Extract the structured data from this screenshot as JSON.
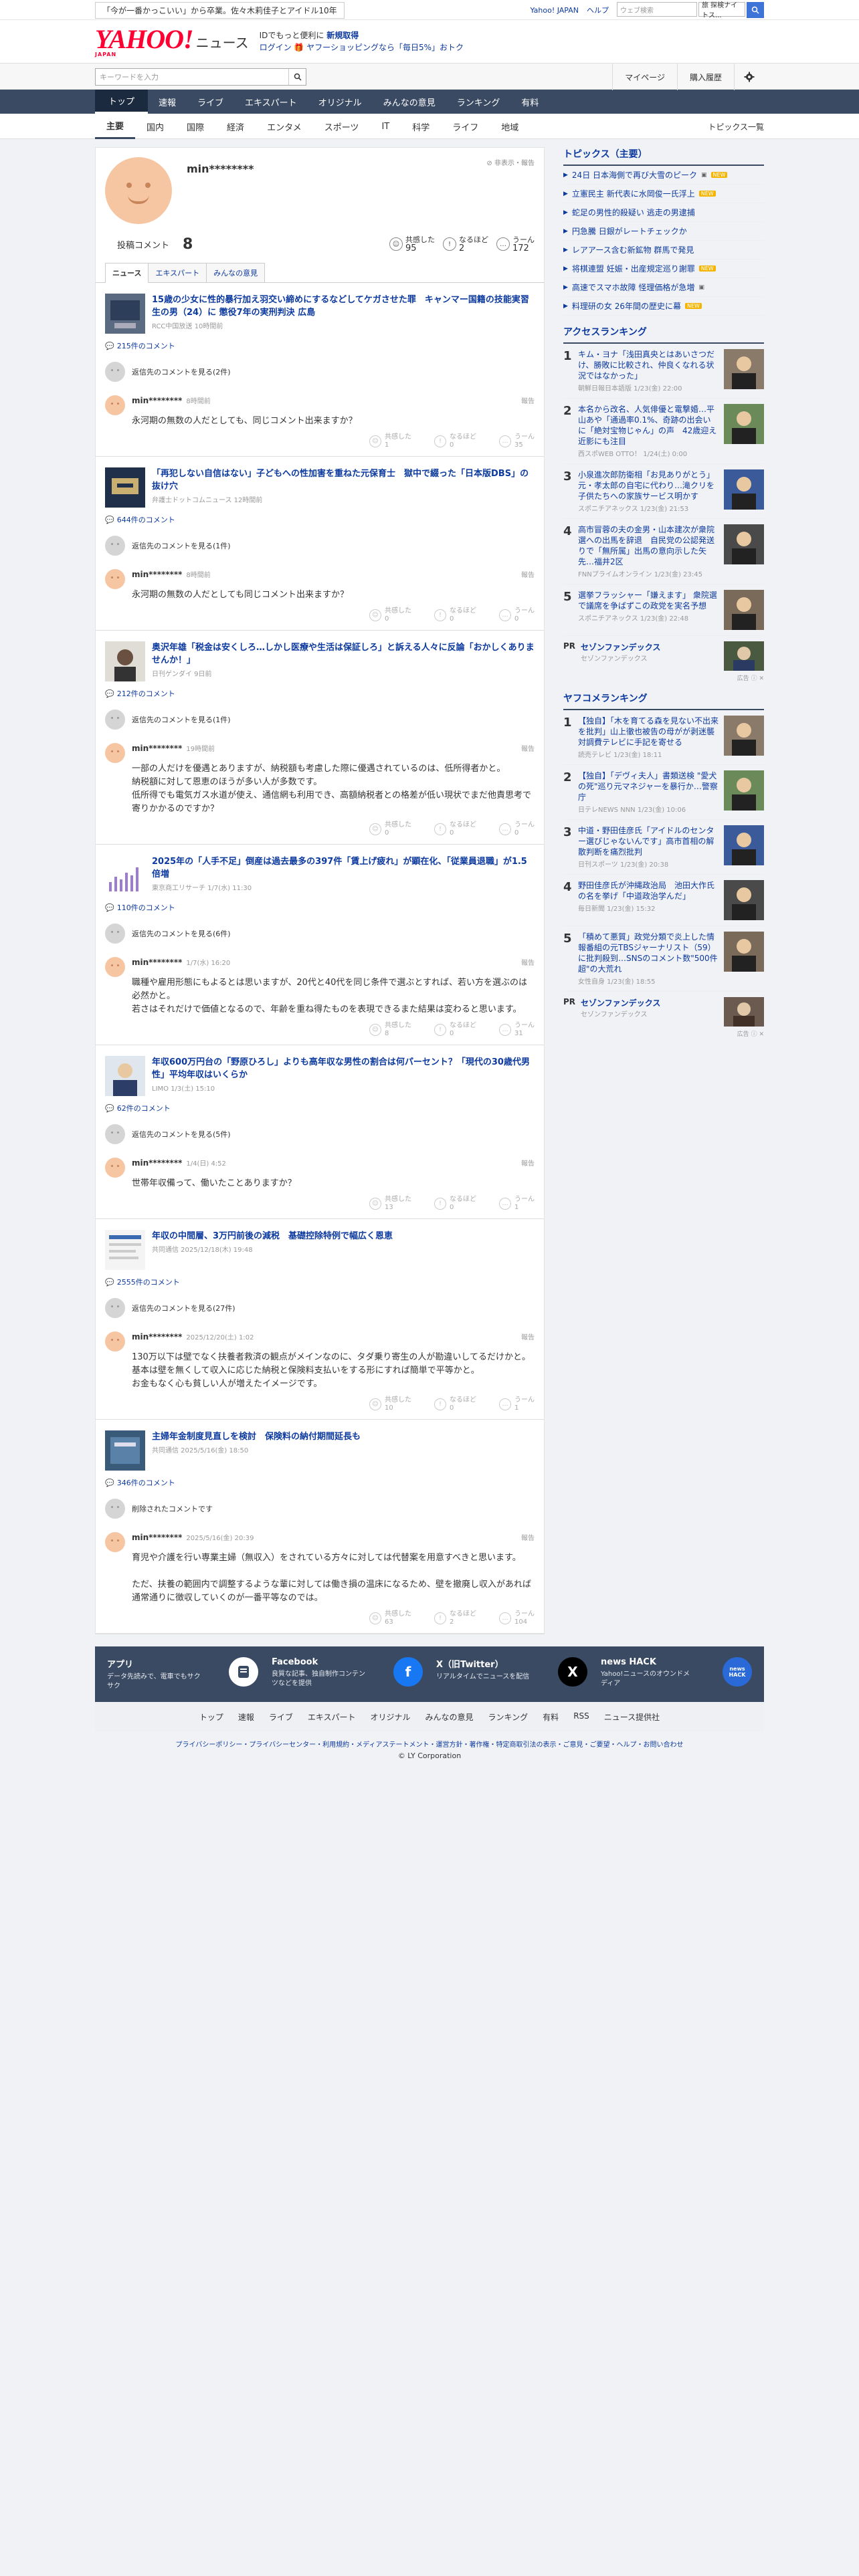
{
  "topbar": {
    "promo": "「今が一番かっこいい」から卒業。佐々木莉佳子とアイドル10年",
    "links": [
      "Yahoo! JAPAN",
      "ヘルプ"
    ],
    "web_placeholder": "ウェブ検索",
    "web_select": "旅 探検ナイトス..."
  },
  "header": {
    "logo": "YAHOO!",
    "logo_sub": "JAPAN",
    "section": "ニュース",
    "promo_line1": "IDでもっと便利に",
    "promo_line1_link": "新規取得",
    "promo_line2": "ログイン 🎁 ヤフーショッピングなら「毎日5%」おトク"
  },
  "search": {
    "placeholder": "キーワードを入力",
    "mypage": "マイページ",
    "history": "購入履歴"
  },
  "mainnav": [
    "トップ",
    "速報",
    "ライブ",
    "エキスパート",
    "オリジナル",
    "みんなの意見",
    "ランキング",
    "有料"
  ],
  "subnav": [
    "主要",
    "国内",
    "国際",
    "経済",
    "エンタメ",
    "スポーツ",
    "IT",
    "科学",
    "ライフ",
    "地域"
  ],
  "subnav_right": "トピックス一覧",
  "profile": {
    "name": "min********",
    "report": "非表示・報告",
    "posts_label": "投稿コメント",
    "posts": "8",
    "reacts": [
      {
        "icon": "☺",
        "label": "共感した",
        "value": "95"
      },
      {
        "icon": "!",
        "label": "なるほど",
        "value": "2"
      },
      {
        "icon": "…",
        "label": "うーん",
        "value": "172"
      }
    ],
    "tabs": [
      "ニュース",
      "エキスパート",
      "みんなの意見"
    ]
  },
  "comments": [
    {
      "title": "15歳の少女に性的暴行加え羽交い締めにするなどしてケガさせた罪　キャンマー国籍の技能実習生の男（24）に 懲役7年の実刑判決 広島",
      "meta": "RCC中国放送 10時間前",
      "count": "215件のコメント",
      "reply": "返信先のコメントを見る(2件)",
      "user": "min********",
      "time": "8時間前",
      "text": "永河期の無数の人だとしても、同じコメント出来ますか？",
      "r": [
        "1",
        "0",
        "35"
      ]
    },
    {
      "title": "「再犯しない自信はない」子どもへの性加害を重ねた元保育士　獄中で綴った「日本版DBS」の抜け穴",
      "meta": "弁護士ドットコムニュース 12時間前",
      "count": "644件のコメント",
      "reply": "返信先のコメントを見る(1件)",
      "user": "min********",
      "time": "8時間前",
      "text": "永河期の無数の人だとしても同じコメント出来ますか？",
      "r": [
        "0",
        "0",
        "0"
      ]
    },
    {
      "title": "奥沢年雄「税金は安くしろ…しかし医療や生活は保証しろ」と訴える人々に反論「おかしくありませんか！」",
      "meta": "日刊ゲンダイ 9日前",
      "count": "212件のコメント",
      "reply": "返信先のコメントを見る(1件)",
      "user": "min********",
      "time": "19時間前",
      "text": "一部の人だけを優遇とありますが、納税額も考慮した際に優遇されているのは、低所得者かと。\n納税額に対して恩恵のほうが多い人が多数です。\n低所得でも電気ガス水道が使え、通信網も利用でき、高額納税者との格差が低い現状でまだ他責思考で寄りかかるのですか？",
      "r": [
        "0",
        "0",
        "0"
      ]
    },
    {
      "title": "2025年の「人手不足」倒産は過去最多の397件「賃上げ疲れ」が顕在化、「従業員退職」が1.5倍増",
      "meta": "東京商工リサーチ 1/7(水) 11:30",
      "count": "110件のコメント",
      "reply": "返信先のコメントを見る(6件)",
      "user": "min********",
      "time": "1/7(水) 16:20",
      "text": "職種や雇用形態にもよるとは思いますが、20代と40代を同じ条件で選ぶとすれば、若い方を選ぶのは必然かと。\n若さはそれだけで価値となるので、年齢を重ね得たものを表現できるまた結果は変わると思います。",
      "r": [
        "8",
        "0",
        "31"
      ]
    },
    {
      "title": "年収600万円台の「野原ひろし」よりも高年収な男性の割合は何パーセント？「現代の30歳代男性」平均年収はいくらか",
      "meta": "LIMO 1/3(土) 15:10",
      "count": "62件のコメント",
      "reply": "返信先のコメントを見る(5件)",
      "user": "min********",
      "time": "1/4(日) 4:52",
      "text": "世帯年収備って、働いたことありますか？",
      "r": [
        "13",
        "0",
        "1"
      ]
    },
    {
      "title": "年収の中間層、3万円前後の減税　基礎控除特例で幅広く恩恵",
      "meta": "共同通信 2025/12/18(木) 19:48",
      "count": "2555件のコメント",
      "reply": "返信先のコメントを見る(27件)",
      "user": "min********",
      "time": "2025/12/20(土) 1:02",
      "text": "130万以下は壁でなく扶養者救済の観点がメインなのに、タダ乗り寄生の人が勘違いしてるだけかと。\n基本は壁を無くして収入に応じた納税と保険料支払いをする形にすれば簡単で平等かと。\nお金もなく心も貧しい人が増えたイメージです。",
      "r": [
        "10",
        "0",
        "1"
      ]
    },
    {
      "title": "主婦年金制度見直しを検討　保険料の納付期間延長も",
      "meta": "共同通信 2025/5/16(金) 18:50",
      "count": "346件のコメント",
      "reply": "削除されたコメントです",
      "user": "min********",
      "time": "2025/5/16(金) 20:39",
      "text": "育児や介護を行い専業主婦（無収入）をされている方々に対しては代替案を用意すべきと思います。\n\nただ、扶養の範囲内で調整するような輩に対しては働き損の温床になるため、壁を撤廃し収入があれば通常通りに徴収していくのが一番平等なのでは。",
      "r": [
        "63",
        "2",
        "104"
      ]
    }
  ],
  "side": {
    "topics_title": "トピックス（主要）",
    "topics": [
      {
        "t": "24日 日本海側で再び大雪のピーク",
        "badge": "cam",
        "new": "NEW"
      },
      {
        "t": "立憲民主 新代表に水岡俊一氏浮上",
        "badge": "",
        "new": "NEW"
      },
      {
        "t": "蛇足の男性的殺疑い 逃走の男逮捕",
        "badge": "",
        "new": ""
      },
      {
        "t": "円急騰 日銀がレートチェックか",
        "badge": "",
        "new": ""
      },
      {
        "t": "レアアース含む新鉱物 群馬で発見",
        "badge": "",
        "new": ""
      },
      {
        "t": "将棋連盟 妊娠・出産規定巡り謝罪",
        "badge": "",
        "new": "NEW"
      },
      {
        "t": "高速でスマホ故障 怪理価格が急増",
        "badge": "cam",
        "new": ""
      },
      {
        "t": "料理研の女 26年間の歴史に幕",
        "badge": "",
        "new": "NEW"
      }
    ],
    "access_title": "アクセスランキング",
    "access": [
      {
        "n": "1",
        "t": "キム・ヨナ「浅田真央とはあいさつだけ、勝敗に比較され、仲良くなれる状況ではなかった」",
        "s": "朝鮮日報日本語版 1/23(金) 22:00"
      },
      {
        "n": "2",
        "t": "本名から改名、人気俳優と電撃婚…平山あや「通過率0.1%、奇跡の出会いに「絶対宝物じゃん」の声　42歳迎え近影にも注目",
        "s": "西スポWEB OTTO！ 1/24(土) 0:00"
      },
      {
        "n": "3",
        "t": "小泉進次郎防衛相「お見ありがとう」元・孝太郎の自宅に代わり…滝クリを子供たちへの家族サービス明かす",
        "s": "スポニチアネックス 1/23(金) 21:53"
      },
      {
        "n": "4",
        "t": "高市冒蓉の夫の金男・山本建次が衆院選への出馬を辞退　自民党の公認発送りで「無所属」出馬の意向示した矢先…福井2区",
        "s": "FNNプライムオンライン 1/23(金) 23:45"
      },
      {
        "n": "5",
        "t": "選挙フラッシャー「嫌えます」 衆院選で議席を争ばずこの政党を実名予想",
        "s": "スポニチアネックス 1/23(金) 22:48"
      }
    ],
    "pr1": {
      "pr": "PR",
      "t": "セゾンファンデックス",
      "s": "セゾンファンデックス"
    },
    "ad_note": "広告",
    "yahoo_title": "ヤフコメランキング",
    "yahoo": [
      {
        "n": "1",
        "t": "【独自】「木を育てる森を見ない不出来を批判」山上徹也被告の母がが剥迷襲対調費テレビに手記を寄せる",
        "s": "読売テレビ 1/23(金) 18:11"
      },
      {
        "n": "2",
        "t": "【独自】「デヴィ夫人」書類送検 \"愛犬の死\"巡り元マネジャーを暴行か…警察庁",
        "s": "日テレNEWS NNN 1/23(金) 10:06"
      },
      {
        "n": "3",
        "t": "中道・野田佳彦氏「アイドルのセンター選びじゃないんです」高市首相の解散判断を痛烈批判",
        "s": "日刊スポーツ 1/23(金) 20:38"
      },
      {
        "n": "4",
        "t": "野田佳彦氏が沖縄政治局　池田大作氏の名を挙げ「中道政治学んだ」",
        "s": "毎日新聞 1/23(金) 15:32"
      },
      {
        "n": "5",
        "t": "「積めて悪質」政党分類で炎上した情報番組の元TBSジャーナリスト（59）に批判殺到…SNSのコメント数\"500件超\"の大荒れ",
        "s": "女性自身 1/23(金) 18:55"
      }
    ],
    "pr2": {
      "pr": "PR",
      "t": "セゾンファンデックス",
      "s": "セゾンファンデックス"
    }
  },
  "footer": {
    "cells": [
      {
        "t": "アプリ",
        "d": "データ先読みで、電車でもサクサク"
      },
      {
        "t": "Facebook",
        "d": "良質な記事、独自制作コンテンツなどを提供"
      },
      {
        "t": "X（旧Twitter）",
        "d": "リアルタイムでニュースを配信"
      },
      {
        "t": "news HACK",
        "d": "Yahoo!ニュースのオウンドメディア"
      }
    ],
    "fb_letter": "f",
    "x_letter": "X",
    "hack_label": "news HACK",
    "links": [
      "トップ",
      "速報",
      "ライブ",
      "エキスパート",
      "オリジナル",
      "みんなの意見",
      "ランキング",
      "有料",
      "RSS",
      "ニュース提供社"
    ],
    "small": "プライバシーポリシー・プライバシーセンター・利用規約・メディアステートメント・運営方針・著作権・特定商取引法の表示・ご意見・ご要望・ヘルプ・お問い合わせ",
    "copyright": "© LY Corporation"
  }
}
